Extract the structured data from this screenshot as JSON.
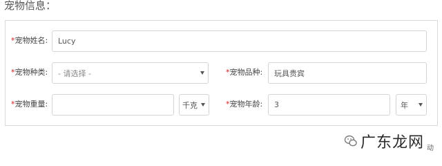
{
  "section_title": "宠物信息：",
  "required_mark": "*",
  "form": {
    "name": {
      "label": "宠物姓名:",
      "value": "Lucy"
    },
    "species": {
      "label": "宠物种类:",
      "value": "- 请选择 -"
    },
    "breed": {
      "label": "宠物品种:",
      "value": "玩具贵宾"
    },
    "weight": {
      "label": "宠物重量:",
      "value": "",
      "unit": "千克"
    },
    "age": {
      "label": "宠物年龄:",
      "value": "3",
      "unit": "年"
    }
  },
  "watermark": {
    "text": "广东龙网",
    "tag": "动",
    "icon": "wechat-icon"
  },
  "colors": {
    "required": "#e02020",
    "border": "#d4d4d4"
  }
}
